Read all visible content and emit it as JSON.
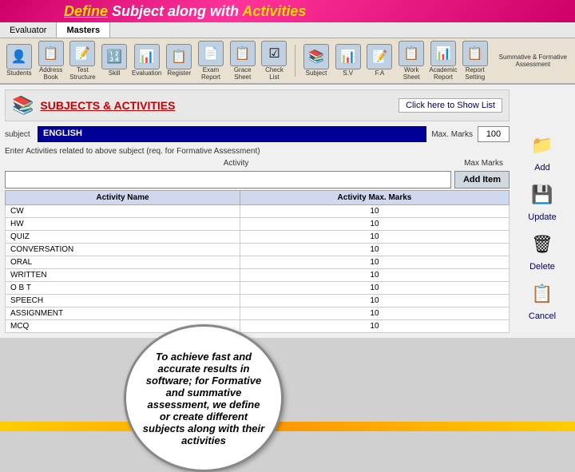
{
  "header": {
    "title_prefix": "Define Subject along with ",
    "title_highlight_define": "Define",
    "title_highlight_subject": "Subject along with",
    "title_activities": "Activities"
  },
  "tabs": [
    {
      "label": "Evaluator",
      "active": false
    },
    {
      "label": "Masters",
      "active": false
    }
  ],
  "toolbar": {
    "items": [
      {
        "icon": "👤",
        "label": "Student\nStudents"
      },
      {
        "icon": "📋",
        "label": "Address Book"
      },
      {
        "icon": "📝",
        "label": "Test Structure"
      },
      {
        "icon": "🔢",
        "label": "Skill"
      },
      {
        "icon": "📊",
        "label": "Evaluation\nEvaluation"
      },
      {
        "icon": "📋",
        "label": "Register"
      },
      {
        "icon": "📄",
        "label": "Exam Report\nExam Report"
      },
      {
        "icon": "📋",
        "label": "Grace Sheet\nGrace Sheet"
      },
      {
        "icon": "☑",
        "label": "Check List"
      },
      {
        "icon": "📚",
        "label": "Subject"
      },
      {
        "icon": "📊",
        "label": "S.V"
      },
      {
        "icon": "📝",
        "label": "F.A"
      },
      {
        "icon": "📋",
        "label": "Work Sheet"
      },
      {
        "icon": "📊",
        "label": "Academic Report"
      },
      {
        "icon": "📋",
        "label": "Report Setting"
      }
    ],
    "group_label": "Summative & Formative Assessment"
  },
  "panel": {
    "title": "SUBJECTS & ACTIVITIES",
    "show_list_label": "Click here to Show List",
    "subject_label": "subject",
    "subject_value": "ENGLISH",
    "max_marks_label": "Max. Marks",
    "max_marks_value": "100",
    "activities_note": "Enter Activities related to above subject (req. for Formative Assessment)",
    "activity_col": "Activity",
    "max_marks_col": "Max Marks",
    "add_item_placeholder": "",
    "add_item_label": "Add Item",
    "table": {
      "headers": [
        "Activity Name",
        "Activity Max. Marks"
      ],
      "rows": [
        {
          "name": "CW",
          "marks": "10"
        },
        {
          "name": "HW",
          "marks": "10"
        },
        {
          "name": "QUIZ",
          "marks": "10"
        },
        {
          "name": "CONVERSATION",
          "marks": "10"
        },
        {
          "name": "ORAL",
          "marks": "10"
        },
        {
          "name": "WRITTEN",
          "marks": "10"
        },
        {
          "name": "O B T",
          "marks": "10"
        },
        {
          "name": "SPEECH",
          "marks": "10"
        },
        {
          "name": "ASSIGNMENT",
          "marks": "10"
        },
        {
          "name": "MCQ",
          "marks": "10"
        }
      ]
    }
  },
  "actions": {
    "add": {
      "icon": "📁",
      "label": "Add"
    },
    "update": {
      "icon": "💾",
      "label": "Update"
    },
    "delete": {
      "icon": "🗑",
      "label": "Delete"
    },
    "cancel": {
      "icon": "📋",
      "label": "Cancel"
    }
  },
  "tooltip": {
    "text": "To achieve fast and accurate results in software; for Formative and summative assessment, we define or create different subjects along with their activities"
  }
}
